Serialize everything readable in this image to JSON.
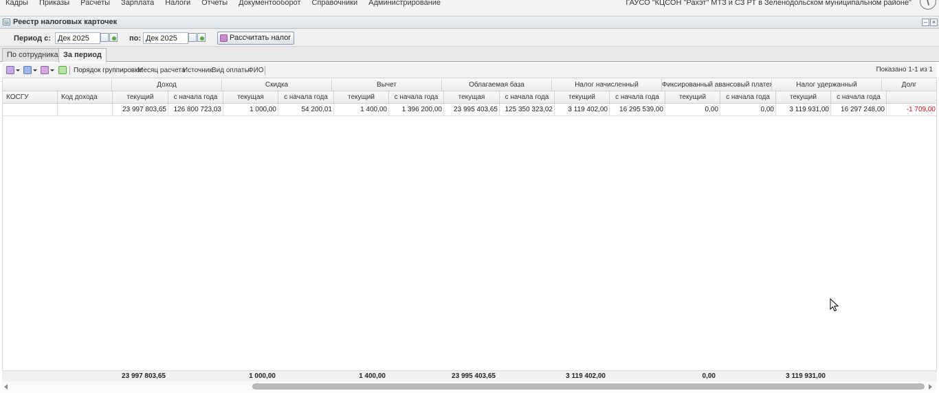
{
  "menu": {
    "items": [
      "Кадры",
      "Приказы",
      "Расчеты",
      "Зарплата",
      "Налоги",
      "Отчеты",
      "Документооборот",
      "Справочники",
      "Администрирование"
    ],
    "organization": "ГАУСО \"КЦСОН \"Рахэт\" МТЗ и СЗ РТ в Зеленодольском муниципальном районе\""
  },
  "window": {
    "title": "Реестр налоговых карточек",
    "minimize_label": "–",
    "close_label": "×"
  },
  "period": {
    "from_label": "Период с:",
    "from_value": "Дек 2025",
    "to_label": "по:",
    "to_value": "Дек 2025",
    "calc_button": "Рассчитать налог"
  },
  "tabs": [
    {
      "label": "По сотрудникам",
      "active": false
    },
    {
      "label": "За период",
      "active": true
    }
  ],
  "toolbar": {
    "grouping_label": "Порядок группировки:",
    "grouping_fields": [
      "Месяц расчета",
      "Источник",
      "Вид оплаты",
      "ФИО"
    ],
    "shown": "Показано 1-1 из 1"
  },
  "grid": {
    "fixed_headers": [
      "КОСГУ",
      "Код дохода"
    ],
    "groups": [
      "Доход",
      "Скидка",
      "Вычет",
      "Облагаемая база",
      "Налог начисленный",
      "Фиксированный авансовый платеж",
      "Налог удержанный",
      "Долг"
    ],
    "subheaders": [
      "текущий",
      "с начала года",
      "текущая",
      "с начала года",
      "текущий",
      "с начала года",
      "текущая",
      "с начала года",
      "текущий",
      "с начала года",
      "текущий",
      "с начала года",
      "текущий",
      "с начала года",
      ""
    ],
    "row": [
      "",
      "",
      "23 997 803,65",
      "126 800 723,03",
      "1 000,00",
      "54 200,01",
      "1 400,00",
      "1 396 200,00",
      "23 995 403,65",
      "125 350 323,02",
      "3 119 402,00",
      "16 295 539,00",
      "0,00",
      "0,00",
      "3 119 931,00",
      "16 297 248,00",
      "-1 709,00"
    ]
  },
  "totals": [
    "23 997 803,65",
    "1 000,00",
    "1 400,00",
    "23 995 403,65",
    "3 119 402,00",
    "0,00",
    "3 119 931,00"
  ],
  "colors": {
    "negative": "#d81010",
    "calc_icon": "#c98bd0"
  },
  "icons": {
    "toolbar": [
      "add-icon",
      "edit-icon",
      "delete-icon",
      "refresh-icon"
    ]
  }
}
